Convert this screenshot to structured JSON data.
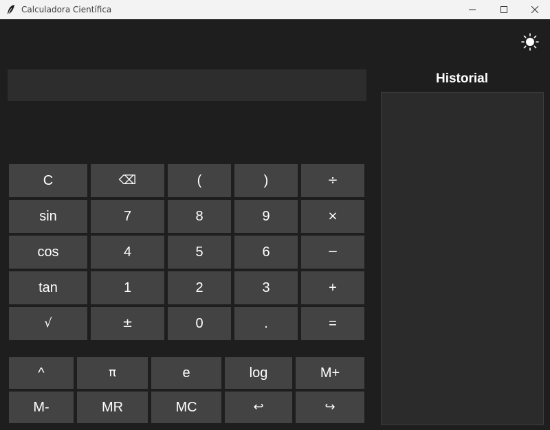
{
  "window": {
    "title": "Calculadora Científica"
  },
  "theme_toggle_icon": "sun-icon",
  "display": {
    "value": ""
  },
  "history": {
    "title": "Historial",
    "entries": []
  },
  "keypad": {
    "rows": [
      [
        "C",
        "⌫",
        "(",
        ")",
        "÷"
      ],
      [
        "sin",
        "7",
        "8",
        "9",
        "×"
      ],
      [
        "cos",
        "4",
        "5",
        "6",
        "−"
      ],
      [
        "tan",
        "1",
        "2",
        "3",
        "+"
      ],
      [
        "√",
        "±",
        "0",
        ".",
        "="
      ]
    ]
  },
  "extra_keys": {
    "rows": [
      [
        "^",
        "π",
        "e",
        "log",
        "M+"
      ],
      [
        "M-",
        "MR",
        "MC",
        "↩",
        "↪"
      ]
    ]
  },
  "colors": {
    "background": "#1e1e1e",
    "button": "#434343",
    "display": "#2d2d2d",
    "history_panel": "#2b2b2b",
    "text": "#ffffff"
  }
}
